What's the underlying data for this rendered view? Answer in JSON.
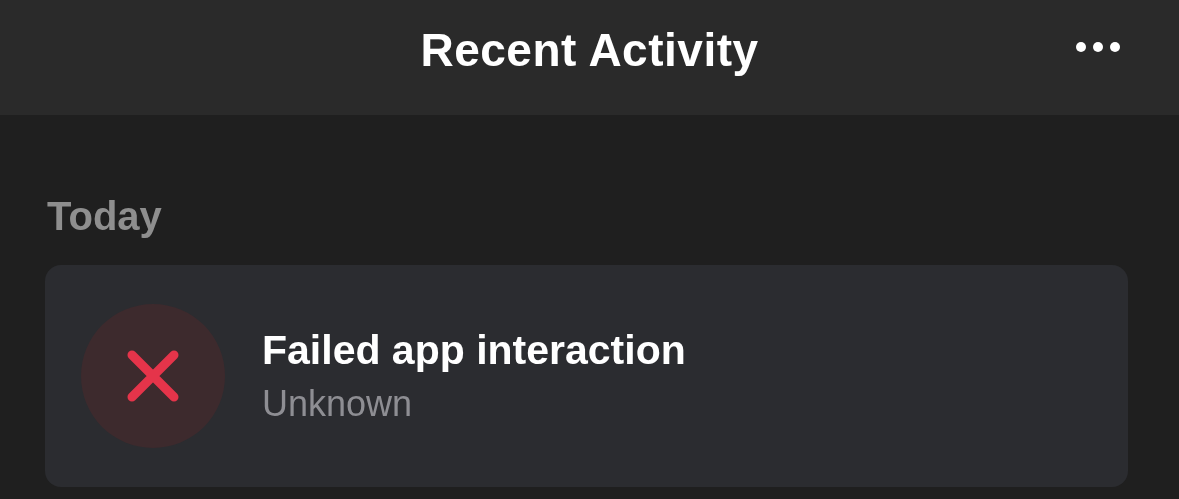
{
  "header": {
    "title": "Recent Activity"
  },
  "sections": [
    {
      "title": "Today",
      "items": [
        {
          "kind": "failed",
          "title": "Failed app interaction",
          "subtitle": "Unknown"
        }
      ]
    }
  ]
}
